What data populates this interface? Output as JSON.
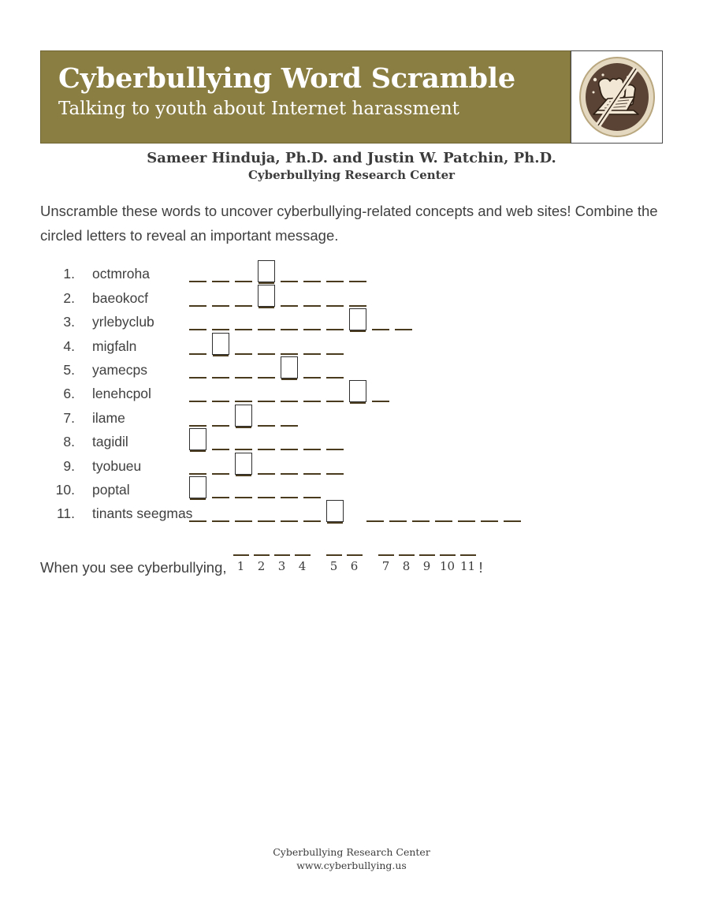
{
  "header": {
    "title": "Cyberbullying Word Scramble",
    "subtitle": "Talking to youth about Internet harassment",
    "band_color": "#8a7e43",
    "logo_icon": "no-cyberbullying-fist-laptop-icon"
  },
  "authors": {
    "line1": "Sameer Hinduja, Ph.D. and Justin W. Patchin, Ph.D.",
    "line2": "Cyberbullying Research Center"
  },
  "instructions": "Unscramble these words to uncover cyberbullying-related concepts and web sites!  Combine the circled letters to reveal an important message.",
  "puzzle": {
    "items": [
      {
        "number": "1.",
        "scrambled": "octmroha",
        "groups": [
          8
        ],
        "circled": [
          4
        ]
      },
      {
        "number": "2.",
        "scrambled": "baeokocf",
        "groups": [
          8
        ],
        "circled": [
          4
        ]
      },
      {
        "number": "3.",
        "scrambled": "yrlebyclub",
        "groups": [
          10
        ],
        "circled": [
          8
        ]
      },
      {
        "number": "4.",
        "scrambled": "migfaln",
        "groups": [
          7
        ],
        "circled": [
          2
        ]
      },
      {
        "number": "5.",
        "scrambled": "yamecps",
        "groups": [
          7
        ],
        "circled": [
          5
        ]
      },
      {
        "number": "6.",
        "scrambled": "lenehcpol",
        "groups": [
          9
        ],
        "circled": [
          8
        ]
      },
      {
        "number": "7.",
        "scrambled": "ilame",
        "groups": [
          5
        ],
        "circled": [
          3
        ]
      },
      {
        "number": "8.",
        "scrambled": "tagidil",
        "groups": [
          7
        ],
        "circled": [
          1
        ]
      },
      {
        "number": "9.",
        "scrambled": "tyobueu",
        "groups": [
          7
        ],
        "circled": [
          3
        ]
      },
      {
        "number": "10.",
        "scrambled": "poptal",
        "groups": [
          6
        ],
        "circled": [
          1
        ]
      },
      {
        "number": "11.",
        "scrambled": "tinants seegmas",
        "groups": [
          7,
          7
        ],
        "circled": [
          7
        ]
      }
    ]
  },
  "answer": {
    "prompt": "When you see cyberbullying,",
    "groups": [
      4,
      2,
      5
    ],
    "numbers": [
      "1",
      "2",
      "3",
      "4",
      "5",
      "6",
      "7",
      "8",
      "9",
      "10",
      "11"
    ],
    "terminator": "!"
  },
  "footer": {
    "organization": "Cyberbullying Research Center",
    "website": "www.cyberbullying.us"
  }
}
